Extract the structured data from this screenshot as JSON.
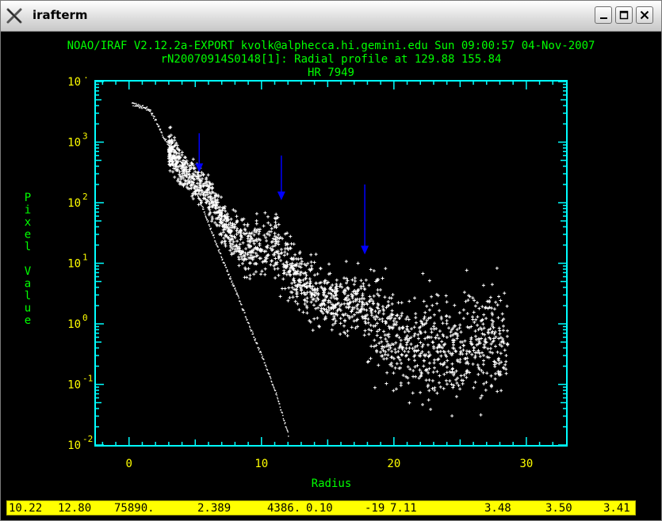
{
  "window": {
    "title": "irafterm",
    "icon": "x-logo-icon",
    "controls": [
      "minimize-icon",
      "maximize-icon",
      "close-icon"
    ]
  },
  "header": {
    "line1": "NOAO/IRAF V2.12.2a-EXPORT kvolk@alphecca.hi.gemini.edu Sun 09:00:57 04-Nov-2007",
    "line2": "rN20070914S0148[1]: Radial profile at 129.88 155.84",
    "line3": "HR 7949"
  },
  "colors": {
    "background": "#000000",
    "axes": "#00ffff",
    "labels": "#00ff00",
    "ticks": "#ffff00",
    "points": "#ffffff",
    "arrows": "#0000ff",
    "status_bg": "#ffff00"
  },
  "chart_data": {
    "type": "scatter",
    "title": "rN20070914S0148[1]: Radial profile at 129.88 155.84",
    "subtitle": "HR 7949",
    "xlabel": "Radius",
    "ylabel": "Pixel Value",
    "xlim": [
      -2.5,
      33
    ],
    "ylim": [
      0.01,
      10000
    ],
    "yscale": "log",
    "xticks": [
      0,
      10,
      20,
      30
    ],
    "yticks": [
      {
        "value": 0.01,
        "base": "10",
        "exp": "-2"
      },
      {
        "value": 0.1,
        "base": "10",
        "exp": "-1"
      },
      {
        "value": 1,
        "base": "10",
        "exp": "0"
      },
      {
        "value": 10,
        "base": "10",
        "exp": "1"
      },
      {
        "value": 100,
        "base": "10",
        "exp": "2"
      },
      {
        "value": 1000,
        "base": "10",
        "exp": "3"
      },
      {
        "value": 10000,
        "base": "10",
        "exp": "4"
      }
    ],
    "grid": false,
    "marker": "+",
    "profile_curve": {
      "x": [
        0.2,
        1.0,
        1.5,
        2.0,
        2.5,
        3.0,
        3.5,
        4.0,
        4.5,
        5.0,
        6.0,
        7.0,
        8.0,
        9.0,
        10.0,
        11.0,
        12.0
      ],
      "y": [
        4300,
        3900,
        3500,
        2300,
        1300,
        900,
        700,
        450,
        280,
        170,
        45,
        12,
        3.6,
        1.0,
        0.3,
        0.08,
        0.015
      ]
    },
    "halo_points": {
      "x": [
        3.0,
        3.5,
        4.0,
        4.5,
        5.0,
        5.5,
        6.0,
        6.5,
        7.0,
        7.5,
        8.0,
        8.5,
        9.0,
        9.5,
        10.0,
        10.5,
        11.0,
        11.5,
        12.0,
        12.5,
        13.0,
        13.5,
        14.0,
        14.5,
        15.0,
        15.5,
        16.0,
        16.5,
        17.0,
        17.5,
        18.0,
        18.5,
        19.0,
        19.5,
        20.0,
        21.0,
        22.0,
        23.0,
        24.0,
        25.0,
        26.0,
        27.0,
        28.0
      ],
      "y": [
        800,
        500,
        350,
        270,
        250,
        180,
        140,
        90,
        55,
        35,
        25,
        20,
        18,
        20,
        18,
        20,
        22,
        15,
        10,
        7,
        5,
        4,
        3.5,
        3,
        2.5,
        2.3,
        2.2,
        2.5,
        2.8,
        2.2,
        1.8,
        1.3,
        1.0,
        0.8,
        0.6,
        0.5,
        0.45,
        0.4,
        0.35,
        0.4,
        0.5,
        0.6,
        0.5
      ]
    },
    "annotations": [
      {
        "type": "arrow",
        "x": 5.3,
        "y_from": 1400,
        "y_to": 320
      },
      {
        "type": "arrow",
        "x": 11.5,
        "y_from": 600,
        "y_to": 110
      },
      {
        "type": "arrow",
        "x": 17.8,
        "y_from": 200,
        "y_to": 14
      }
    ]
  },
  "status_bar": {
    "fields": [
      "10.22",
      "12.80",
      "75890.",
      "2.389",
      "4386.",
      "0.10",
      "-19",
      "7.11",
      "3.48",
      "3.50",
      "3.41"
    ]
  }
}
